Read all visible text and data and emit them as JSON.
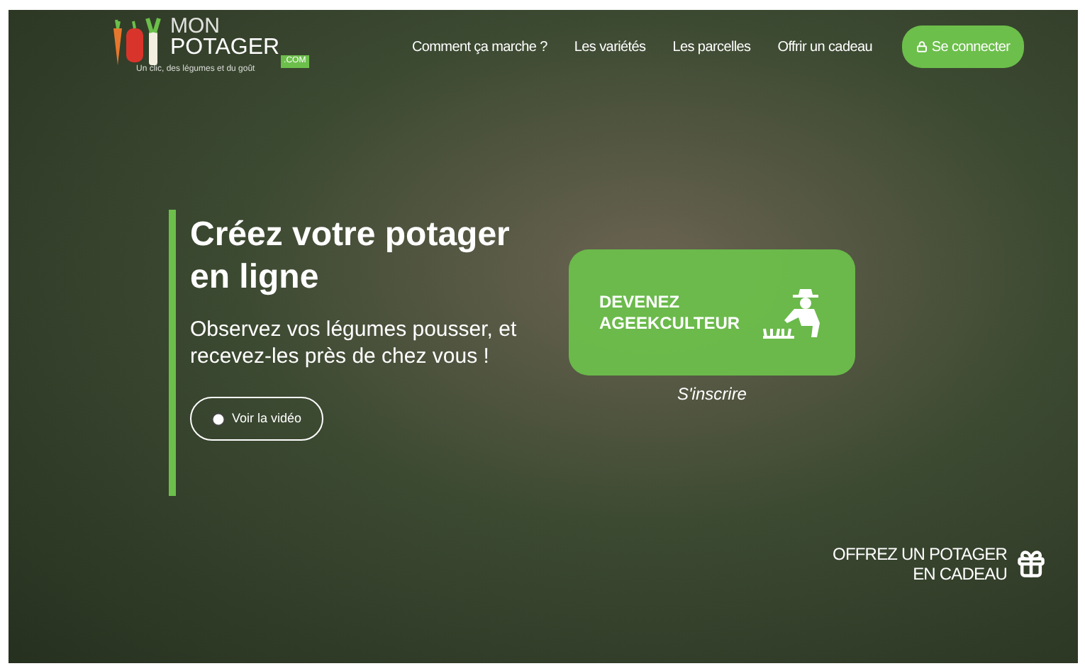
{
  "logo": {
    "line1": "MON",
    "line2": "POTAGER",
    "badge": ".COM",
    "tagline": "Un clic, des légumes et du goût"
  },
  "nav": [
    {
      "label": "Comment ça marche ?"
    },
    {
      "label": "Les variétés"
    },
    {
      "label": "Les parcelles"
    },
    {
      "label": "Offrir un cadeau"
    }
  ],
  "login_button": "Se connecter",
  "hero": {
    "title": "Créez votre potager en ligne",
    "subtitle": "Observez vos légumes pousser, et recevez-les près de chez vous !",
    "video_button": "Voir la vidéo"
  },
  "cta": {
    "line1": "DEVENEZ",
    "line2": "AGEEKCULTEUR",
    "caption": "S'inscrire"
  },
  "gift": {
    "line1": "OFFREZ UN POTAGER",
    "line2": "EN CADEAU"
  }
}
